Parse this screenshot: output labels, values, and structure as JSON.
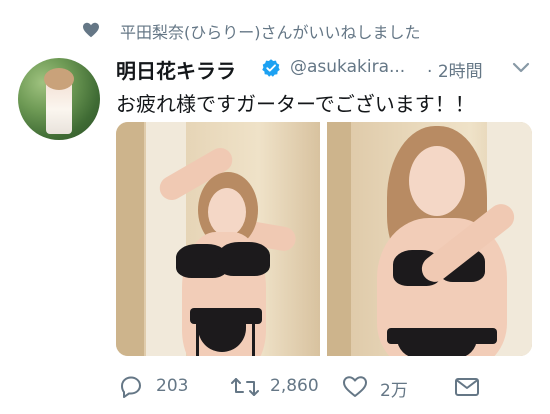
{
  "social_context": {
    "text": "平田梨奈(ひらりー)さんがいいねしました",
    "icon": "heart-icon"
  },
  "tweet": {
    "author_name": "明日花キララ",
    "verified": true,
    "handle": "@asukakira...",
    "separator": "·",
    "timestamp": "2時間",
    "text": "お疲れ様ですガーターでございます！！",
    "media_count": 2
  },
  "actions": {
    "reply_count": "203",
    "retweet_count": "2,860",
    "like_count": "2万"
  },
  "colors": {
    "secondary_text": "#657786",
    "primary_text": "#14171a",
    "verified_blue": "#1da1f2"
  }
}
